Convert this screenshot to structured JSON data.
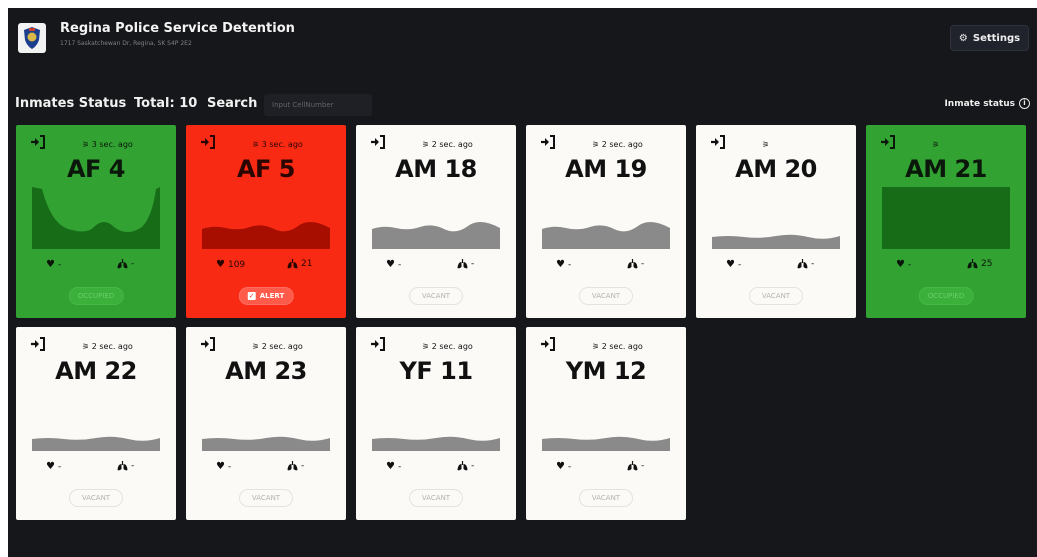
{
  "header": {
    "title": "Regina Police Service Detention",
    "address": "1717 Saskatchewan Dr, Regina, SK S4P 2E2",
    "settings_label": "Settings",
    "settings_icon": "gear-icon"
  },
  "toolbar": {
    "title": "Inmates Status",
    "total": "Total: 10",
    "search_label": "Search",
    "search_placeholder": "Input CellNumber",
    "search_value": "",
    "inmate_status_label": "Inmate status",
    "inmate_status_icon": "info-icon"
  },
  "cards": [
    {
      "name": "AF 4",
      "time": "3 sec. ago",
      "status": "occupied",
      "badge": "OCCUPIED",
      "heart": "-",
      "lung": "-",
      "wave": "dip"
    },
    {
      "name": "AF 5",
      "time": "3 sec. ago",
      "status": "alert",
      "badge": "ALERT",
      "heart": "109",
      "lung": "21",
      "wave": "low"
    },
    {
      "name": "AM 18",
      "time": "2 sec. ago",
      "status": "vacant",
      "badge": "VACANT",
      "heart": "-",
      "lung": "-",
      "wave": "low"
    },
    {
      "name": "AM 19",
      "time": "2 sec. ago",
      "status": "vacant",
      "badge": "VACANT",
      "heart": "-",
      "lung": "-",
      "wave": "low"
    },
    {
      "name": "AM 20",
      "time": "",
      "status": "vacant",
      "badge": "VACANT",
      "heart": "-",
      "lung": "-",
      "wave": "flat"
    },
    {
      "name": "AM 21",
      "time": "",
      "status": "occupied",
      "badge": "OCCUPIED",
      "heart": "-",
      "lung": "25",
      "wave": "block"
    },
    {
      "name": "AM 22",
      "time": "2 sec. ago",
      "status": "vacant",
      "badge": "VACANT",
      "heart": "-",
      "lung": "-",
      "wave": "flat"
    },
    {
      "name": "AM 23",
      "time": "2 sec. ago",
      "status": "vacant",
      "badge": "VACANT",
      "heart": "-",
      "lung": "-",
      "wave": "flat"
    },
    {
      "name": "YF 11",
      "time": "2 sec. ago",
      "status": "vacant",
      "badge": "VACANT",
      "heart": "-",
      "lung": "-",
      "wave": "flat"
    },
    {
      "name": "YM 12",
      "time": "2 sec. ago",
      "status": "vacant",
      "badge": "VACANT",
      "heart": "-",
      "lung": "-",
      "wave": "flat"
    }
  ],
  "colors": {
    "background": "#16171a",
    "vacant_card": "#fbfaf7",
    "occupied_card": "#32a232",
    "alert_card": "#f92a13",
    "wave_vacant": "#8a8a8a",
    "wave_occupied": "#176d17",
    "wave_alert": "#a80e00"
  }
}
